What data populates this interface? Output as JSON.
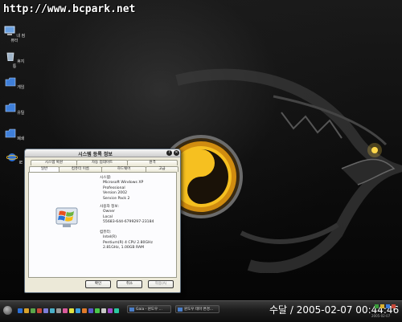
{
  "desktop": {
    "watermark": "http://www.bcpark.net",
    "icons": [
      {
        "name": "computer",
        "label": "내 컴퓨터"
      },
      {
        "name": "recycle",
        "label": "휴지통"
      },
      {
        "name": "folder",
        "label": "게임"
      },
      {
        "name": "folder",
        "label": "유틸"
      },
      {
        "name": "folder",
        "label": "폐쇄"
      },
      {
        "name": "ie",
        "label": "IE"
      }
    ]
  },
  "dialog": {
    "title": "시스템 등록 정보",
    "help_glyph": "?",
    "close_glyph": "✕",
    "tabs_top": [
      "시스템 복원",
      "자동 업데이트",
      "원격"
    ],
    "tabs_bottom": [
      "일반",
      "컴퓨터 이름",
      "하드웨어",
      "고급"
    ],
    "system_heading": "시스템:",
    "system_lines": [
      "Microsoft Windows XP",
      "Professional",
      "Version 2002",
      "Service Pack 2"
    ],
    "user_heading": "사용자 정보:",
    "user_lines": [
      "Owner",
      "Local",
      "55683-644-6799297-23184"
    ],
    "computer_heading": "컴퓨터:",
    "computer_lines": [
      "Intel(R)",
      "Pentium(R) 4 CPU 2.80GHz",
      "2.81GHz, 1.00GB RAM"
    ],
    "buttons": {
      "ok": "확인",
      "cancel": "취소",
      "apply": "적용(A)"
    }
  },
  "taskbar": {
    "tasks": [
      "Gaia - 윈도우 ...",
      "윈도우 테마 변경..."
    ],
    "clock": "수달 / 2005-02-07 00:44:46",
    "tray_date": "2005-02-07"
  }
}
